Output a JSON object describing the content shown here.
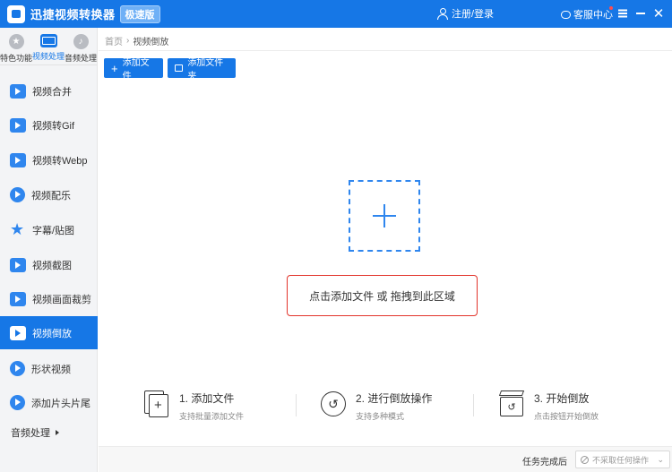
{
  "titlebar": {
    "app_title": "迅捷视频转换器",
    "edition_badge": "极速版",
    "login_label": "注册/登录",
    "service_label": "客服中心"
  },
  "sidebar": {
    "top_tabs": [
      {
        "label": "特色功能",
        "icon": "star-icon"
      },
      {
        "label": "视频处理",
        "icon": "film-icon"
      },
      {
        "label": "音频处理",
        "icon": "music-disc-icon"
      }
    ],
    "items": [
      {
        "label": "视频合并",
        "icon": "video-merge-icon"
      },
      {
        "label": "视频转Gif",
        "icon": "gif-icon"
      },
      {
        "label": "视频转Webp",
        "icon": "webp-icon"
      },
      {
        "label": "视频配乐",
        "icon": "music-play-icon"
      },
      {
        "label": "字幕/贴图",
        "icon": "star-sticker-icon"
      },
      {
        "label": "视频截图",
        "icon": "screenshot-icon"
      },
      {
        "label": "视频画面裁剪",
        "icon": "crop-icon"
      },
      {
        "label": "视频倒放",
        "icon": "reverse-play-icon"
      },
      {
        "label": "形状视频",
        "icon": "shape-video-icon"
      },
      {
        "label": "添加片头片尾",
        "icon": "intro-outro-icon"
      }
    ],
    "active_index": 7,
    "audio_section_label": "音频处理"
  },
  "breadcrumb": {
    "home": "首页",
    "current": "视频倒放"
  },
  "toolbar": {
    "add_file": "添加文件",
    "add_folder": "添加文件夹"
  },
  "dropzone": {
    "hint": "点击添加文件 或 拖拽到此区域"
  },
  "steps": [
    {
      "title": "1. 添加文件",
      "desc": "支持批量添加文件"
    },
    {
      "title": "2. 进行倒放操作",
      "desc": "支持多种模式"
    },
    {
      "title": "3. 开始倒放",
      "desc": "点击按钮开始倒放"
    }
  ],
  "footer": {
    "label": "任务完成后",
    "select_value": "不采取任何操作"
  },
  "colors": {
    "accent": "#1677e6",
    "highlight_border": "#e2342b"
  }
}
